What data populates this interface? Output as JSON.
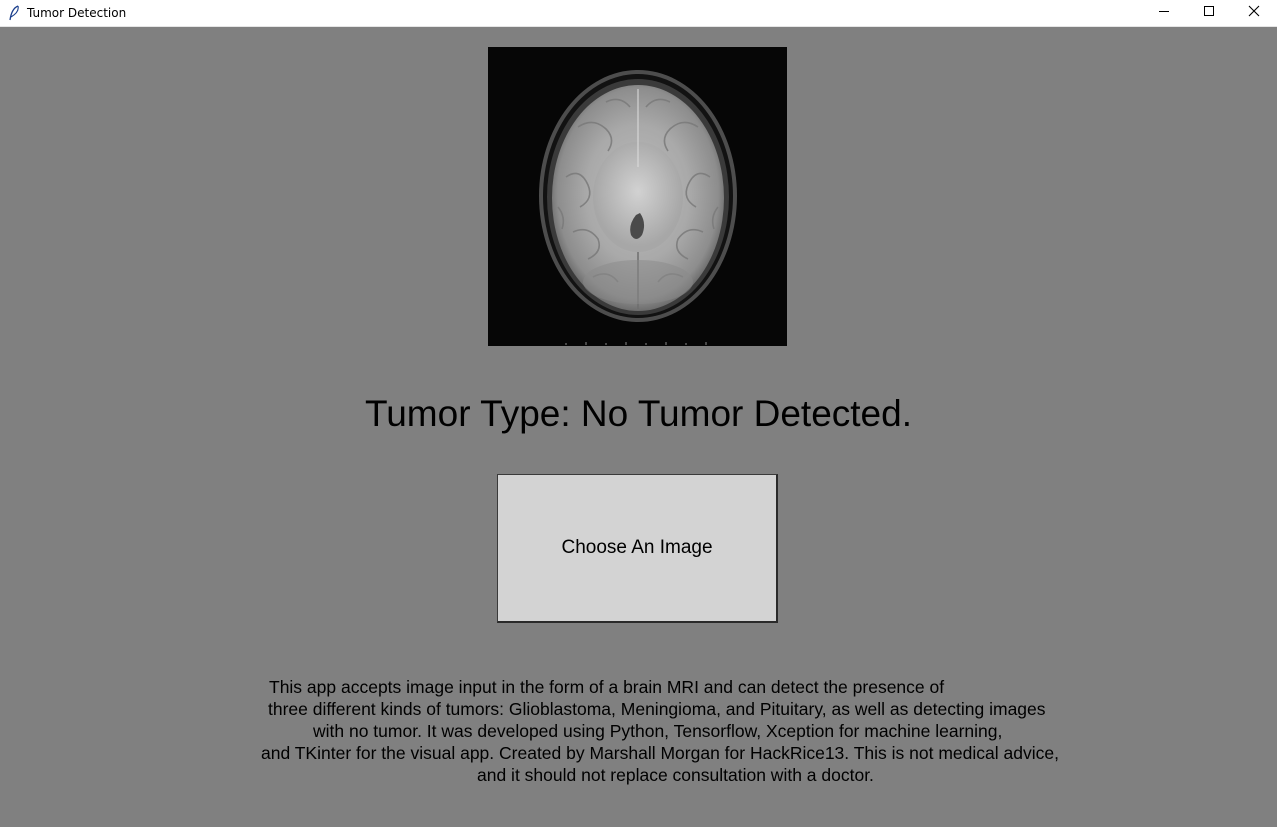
{
  "window": {
    "title": "Tumor Detection",
    "icon": "feather-icon",
    "controls": [
      "minimize-icon",
      "maximize-icon",
      "close-icon"
    ]
  },
  "image": {
    "alt": "brain MRI scan"
  },
  "result": {
    "text": "Tumor Type: No Tumor Detected."
  },
  "button": {
    "label": "Choose An Image"
  },
  "description": {
    "lines": [
      "This app accepts image input in the form of a brain MRI and can detect the presence of",
      "three different kinds of tumors: Glioblastoma, Meningioma, and Pituitary, as well as detecting images",
      "with no tumor. It was developed using Python, Tensorflow, Xception for machine learning,",
      "and TKinter for the visual app. Created by Marshall Morgan for HackRice13. This is not medical advice,",
      "and it should not replace consultation with a doctor."
    ]
  },
  "colors": {
    "background": "#808080",
    "button": "#d3d3d3",
    "titlebar": "#ffffff"
  }
}
